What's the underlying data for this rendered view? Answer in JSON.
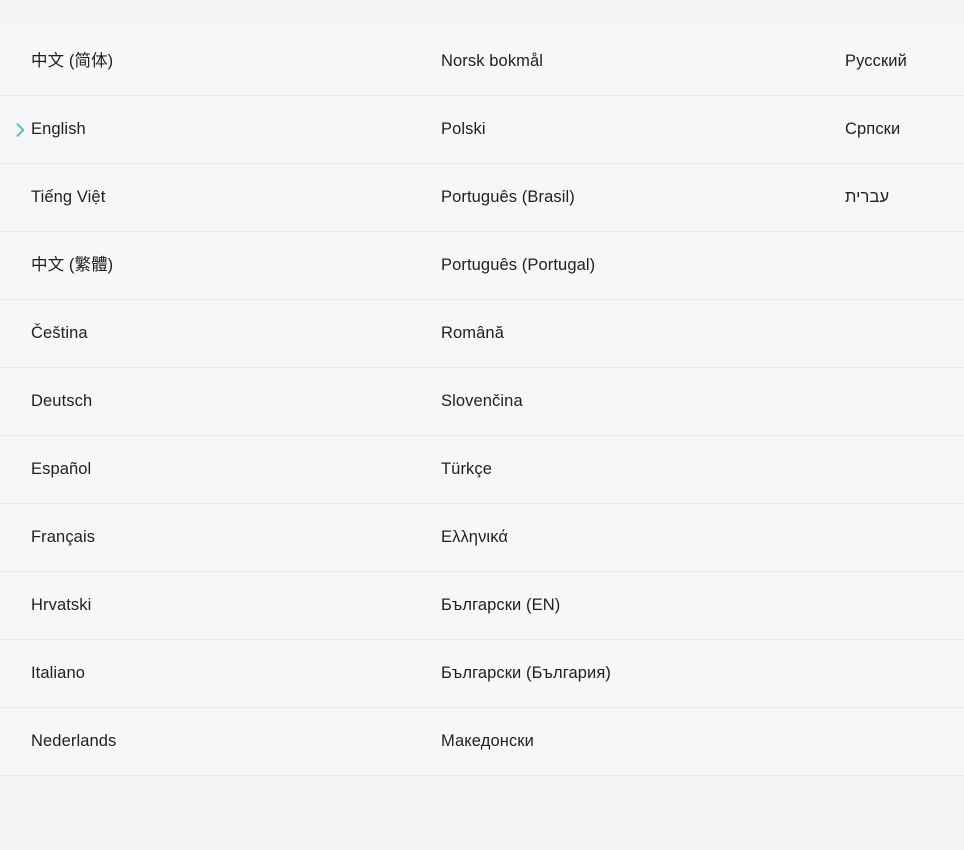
{
  "theme": {
    "page_background": "#f5f4f7",
    "row_background": "#f7f6f9",
    "row_separator": "#eceaf0",
    "text_color": "#202124",
    "selection_accent": "#5bc0c0"
  },
  "selection": {
    "selected_language": "English",
    "marker_icon": "chevron-right-icon"
  },
  "language_picker": {
    "columns": 3,
    "rows": [
      {
        "col1": "中文 (简体)",
        "col2": "Norsk bokmål",
        "col3": "Русский",
        "col3_rtl": false,
        "selected": false
      },
      {
        "col1": "English",
        "col2": "Polski",
        "col3": "Српски",
        "col3_rtl": false,
        "selected": true
      },
      {
        "col1": "Tiếng Việt",
        "col2": "Português (Brasil)",
        "col3": "עברית",
        "col3_rtl": true,
        "selected": false
      },
      {
        "col1": "中文 (繁體)",
        "col2": "Português (Portugal)",
        "col3": "",
        "col3_rtl": false,
        "selected": false
      },
      {
        "col1": "Čeština",
        "col2": "Română",
        "col3": "",
        "col3_rtl": false,
        "selected": false
      },
      {
        "col1": "Deutsch",
        "col2": "Slovenčina",
        "col3": "",
        "col3_rtl": false,
        "selected": false
      },
      {
        "col1": "Español",
        "col2": "Türkçe",
        "col3": "",
        "col3_rtl": false,
        "selected": false
      },
      {
        "col1": "Français",
        "col2": "Ελληνικά",
        "col3": "",
        "col3_rtl": false,
        "selected": false
      },
      {
        "col1": "Hrvatski",
        "col2": "Български (EN)",
        "col3": "",
        "col3_rtl": false,
        "selected": false
      },
      {
        "col1": "Italiano",
        "col2": "Български (България)",
        "col3": "",
        "col3_rtl": false,
        "selected": false
      },
      {
        "col1": "Nederlands",
        "col2": "Македонски",
        "col3": "",
        "col3_rtl": false,
        "selected": false
      }
    ]
  }
}
